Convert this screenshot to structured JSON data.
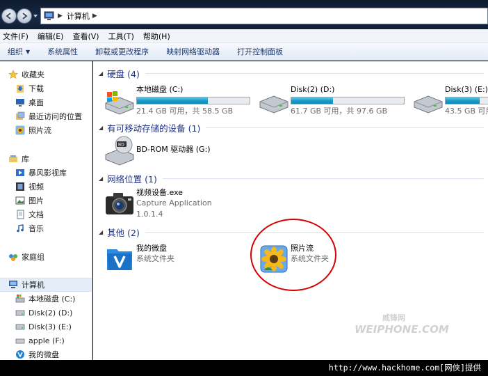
{
  "address": {
    "crumb": "计算机"
  },
  "menubar": {
    "items": [
      "文件(F)",
      "编辑(E)",
      "查看(V)",
      "工具(T)",
      "帮助(H)"
    ]
  },
  "commandbar": {
    "items": [
      "组织",
      "系统属性",
      "卸载或更改程序",
      "映射网络驱动器",
      "打开控制面板"
    ]
  },
  "navpane": {
    "favorites": "收藏夹",
    "fav_items": [
      "下载",
      "桌面",
      "最近访问的位置",
      "照片流"
    ],
    "libraries": "库",
    "lib_items": [
      "暴风影视库",
      "视频",
      "图片",
      "文档",
      "音乐"
    ],
    "homegroup": "家庭组",
    "computer": "计算机",
    "comp_items": [
      "本地磁盘 (C:)",
      "Disk(2) (D:)",
      "Disk(3) (E:)",
      "apple (F:)",
      "我的微盘"
    ]
  },
  "groups": {
    "hdd": "硬盘 (4)",
    "removable": "有可移动存储的设备 (1)",
    "network": "网络位置 (1)",
    "other": "其他 (2)"
  },
  "drives": [
    {
      "name": "本地磁盘 (C:)",
      "info": "21.4 GB 可用，共 58.5 GB",
      "used_fraction": 0.63
    },
    {
      "name": "Disk(2) (D:)",
      "info": "61.7 GB 可用，共 97.6 GB",
      "used_fraction": 0.37
    },
    {
      "name": "Disk(3) (E:)",
      "info": "43.5 GB 可用",
      "used_fraction": 0.5
    }
  ],
  "removable": {
    "name": "BD-ROM 驱动器 (G:)"
  },
  "network_item": {
    "name": "视频设备.exe",
    "line2": "Capture Application",
    "line3": "1.0.1.4"
  },
  "others": [
    {
      "name": "我的微盘",
      "sub": "系统文件夹"
    },
    {
      "name": "照片流",
      "sub": "系统文件夹"
    }
  ],
  "watermark": {
    "brand": "WEIPHONE.COM",
    "cn": "威锋网"
  },
  "footer": {
    "credit": "http://www.hackhome.com[网侠]提供"
  },
  "colors": {
    "accent": "#1e3287",
    "bar": "#1a9bc9",
    "annotation": "#d40000"
  }
}
